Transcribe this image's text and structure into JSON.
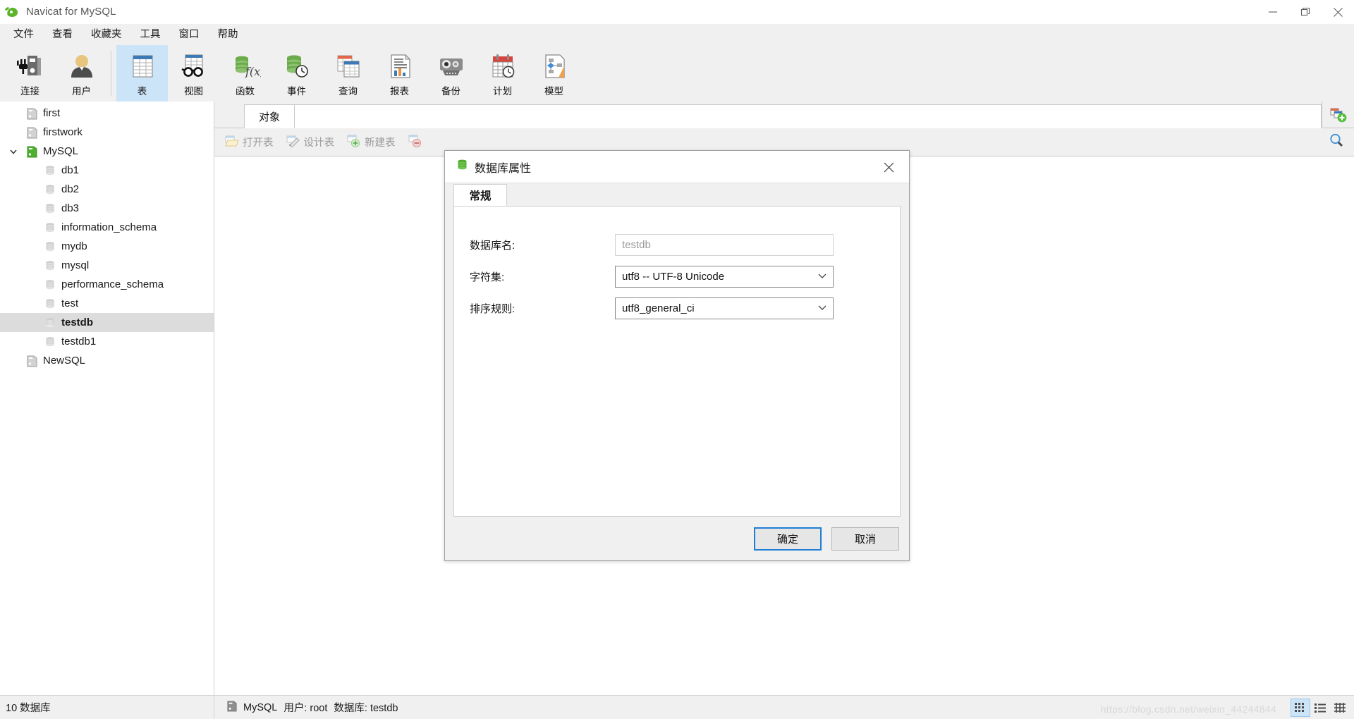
{
  "window": {
    "title": "Navicat for MySQL",
    "logo_icon": "navicat-leaf-icon",
    "minimize_icon": "minimize-icon",
    "restore_icon": "restore-icon",
    "close_icon": "close-icon"
  },
  "menubar": {
    "items": [
      {
        "label": "文件",
        "name": "menu-file"
      },
      {
        "label": "查看",
        "name": "menu-view"
      },
      {
        "label": "收藏夹",
        "name": "menu-favorites"
      },
      {
        "label": "工具",
        "name": "menu-tools"
      },
      {
        "label": "窗口",
        "name": "menu-window"
      },
      {
        "label": "帮助",
        "name": "menu-help"
      }
    ]
  },
  "toolbar": {
    "buttons": [
      {
        "label": "连接",
        "icon": "connection-icon",
        "active": false
      },
      {
        "label": "用户",
        "icon": "user-icon",
        "active": false
      },
      {
        "label": "表",
        "icon": "table-icon",
        "active": true
      },
      {
        "label": "视图",
        "icon": "view-glasses-icon",
        "active": false
      },
      {
        "label": "函数",
        "icon": "function-fx-icon",
        "active": false
      },
      {
        "label": "事件",
        "icon": "event-clock-icon",
        "active": false
      },
      {
        "label": "查询",
        "icon": "query-icon",
        "active": false
      },
      {
        "label": "报表",
        "icon": "report-chart-icon",
        "active": false
      },
      {
        "label": "备份",
        "icon": "backup-tape-icon",
        "active": false
      },
      {
        "label": "计划",
        "icon": "schedule-calendar-icon",
        "active": false
      },
      {
        "label": "模型",
        "icon": "model-diagram-icon",
        "active": false
      }
    ]
  },
  "sidebar": {
    "items": [
      {
        "label": "first",
        "icon": "server-gray-icon",
        "level": 1,
        "expander": "",
        "selected": false
      },
      {
        "label": "firstwork",
        "icon": "server-gray-icon",
        "level": 1,
        "expander": "",
        "selected": false
      },
      {
        "label": "MySQL",
        "icon": "server-green-icon",
        "level": 0,
        "expander": "chevron-down-icon",
        "selected": false
      },
      {
        "label": "db1",
        "icon": "database-icon",
        "level": 2,
        "expander": "",
        "selected": false
      },
      {
        "label": "db2",
        "icon": "database-icon",
        "level": 2,
        "expander": "",
        "selected": false
      },
      {
        "label": "db3",
        "icon": "database-icon",
        "level": 2,
        "expander": "",
        "selected": false
      },
      {
        "label": "information_schema",
        "icon": "database-icon",
        "level": 2,
        "expander": "",
        "selected": false
      },
      {
        "label": "mydb",
        "icon": "database-icon",
        "level": 2,
        "expander": "",
        "selected": false
      },
      {
        "label": "mysql",
        "icon": "database-icon",
        "level": 2,
        "expander": "",
        "selected": false
      },
      {
        "label": "performance_schema",
        "icon": "database-icon",
        "level": 2,
        "expander": "",
        "selected": false
      },
      {
        "label": "test",
        "icon": "database-icon",
        "level": 2,
        "expander": "",
        "selected": false
      },
      {
        "label": "testdb",
        "icon": "database-icon",
        "level": 2,
        "expander": "",
        "selected": true
      },
      {
        "label": "testdb1",
        "icon": "database-icon",
        "level": 2,
        "expander": "",
        "selected": false
      },
      {
        "label": "NewSQL",
        "icon": "server-gray-icon",
        "level": 1,
        "expander": "",
        "selected": false
      }
    ]
  },
  "main": {
    "tab_label": "对象",
    "add_tab_icon": "new-tab-icon",
    "search_icon": "search-icon",
    "object_buttons": [
      {
        "label": "打开表",
        "icon": "open-table-icon"
      },
      {
        "label": "设计表",
        "icon": "design-table-icon"
      },
      {
        "label": "新建表",
        "icon": "new-table-icon"
      },
      {
        "label": "",
        "icon": "delete-table-icon"
      }
    ]
  },
  "dialog": {
    "title": "数据库属性",
    "title_icon": "database-icon",
    "close_icon": "close-icon",
    "tab_label": "常规",
    "fields": {
      "db_name_label": "数据库名:",
      "db_name_value": "testdb",
      "charset_label": "字符集:",
      "charset_value": "utf8 -- UTF-8 Unicode",
      "collation_label": "排序规则:",
      "collation_value": "utf8_general_ci"
    },
    "ok_label": "确定",
    "cancel_label": "取消"
  },
  "statusbar": {
    "db_count": "10 数据库",
    "server_icon": "server-gray-icon",
    "connection": "MySQL",
    "user": "用户: root",
    "database": "数据库: testdb",
    "watermark": "https://blog.csdn.net/weixin_44244844",
    "view_buttons": [
      {
        "icon": "grid-view-icon",
        "active": true
      },
      {
        "icon": "list-view-icon",
        "active": false
      },
      {
        "icon": "detail-view-icon",
        "active": false
      }
    ]
  },
  "colors": {
    "accent": "#cce4f7",
    "green": "#5ab52b",
    "focus_blue": "#1f7fd6"
  }
}
